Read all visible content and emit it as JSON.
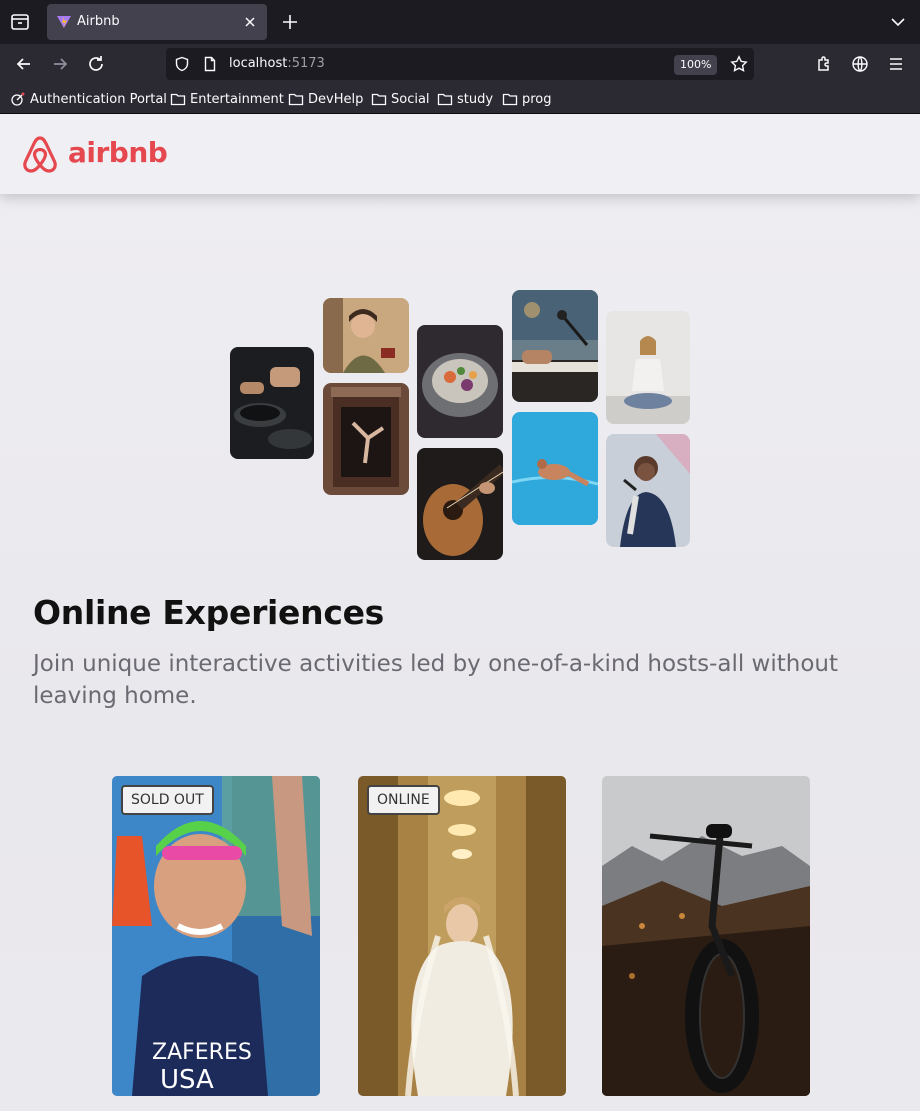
{
  "browser": {
    "tab_title": "Airbnb",
    "url_host": "localhost",
    "url_port": ":5173",
    "zoom": "100%",
    "bookmarks": [
      "Authentication Portal",
      "Entertainment",
      "DevHelp",
      "Social",
      "study",
      "prog"
    ]
  },
  "header": {
    "logo_text": "airbnb",
    "brand_color": "#e5484f"
  },
  "hero": {
    "title": "Online Experiences",
    "subtitle": "Join unique interactive activities led by one-of-a-kind hosts-all without leaving home."
  },
  "cards": [
    {
      "badge": "SOLD OUT"
    },
    {
      "badge": "ONLINE"
    },
    {
      "badge": ""
    }
  ]
}
